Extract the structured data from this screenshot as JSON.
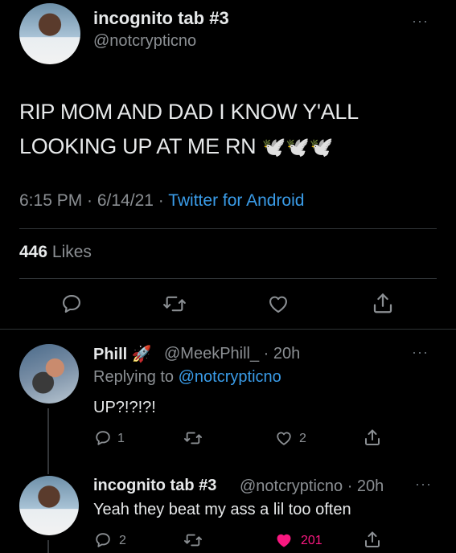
{
  "main_tweet": {
    "name": "incognito tab #3",
    "handle": "@notcrypticno",
    "text_line1": "RIP MOM AND DAD I KNOW Y'ALL",
    "text_line2": "LOOKING UP AT ME RN",
    "emoji": "🕊️🕊️🕊️",
    "time": "6:15 PM · 6/14/21 · ",
    "source": "Twitter for Android",
    "likes_count": "446",
    "likes_label": "Likes",
    "more": "···"
  },
  "reply1": {
    "name": "Phill",
    "emoji": "🚀",
    "handle_time": "@MeekPhill_ · 20h",
    "replying_prefix": "Replying to ",
    "replying_handle": "@notcrypticno",
    "text": "UP?!?!?!",
    "reply_count": "1",
    "like_count": "2",
    "more": "···"
  },
  "reply2": {
    "name": "incognito tab #3",
    "handle_time": "@notcrypticno · 20h",
    "text": "Yeah they beat my ass a lil too often",
    "reply_count": "2",
    "like_count": "201",
    "more": "···"
  },
  "colors": {
    "background": "#000000",
    "link": "#3a9ce8",
    "muted": "#8b8f93",
    "like_active": "#f91880"
  }
}
